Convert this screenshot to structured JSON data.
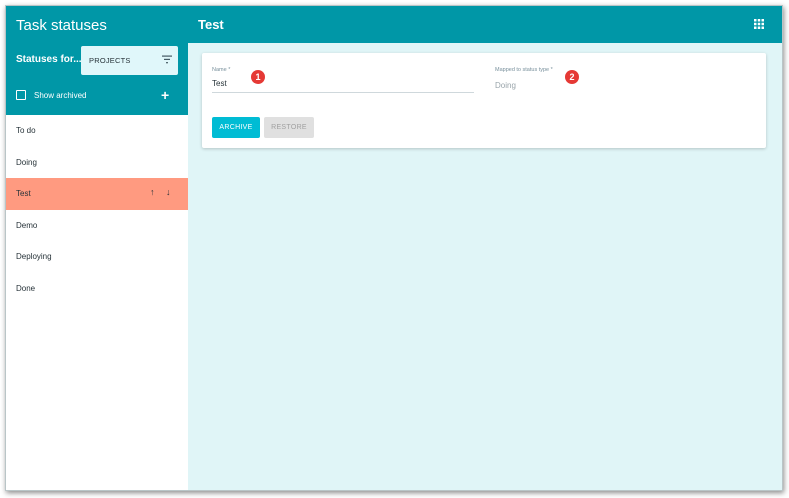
{
  "sidebar": {
    "title": "Task statuses",
    "statuses_for_label": "Statuses for...",
    "projects_select": {
      "value": "PROJECTS",
      "icon": "filter-icon"
    },
    "show_archived_label": "Show archived",
    "show_archived_checked": false,
    "add_icon": "plus-icon",
    "items": [
      {
        "label": "To do"
      },
      {
        "label": "Doing"
      },
      {
        "label": "Test",
        "active": true
      },
      {
        "label": "Demo"
      },
      {
        "label": "Deploying"
      },
      {
        "label": "Done"
      }
    ]
  },
  "main": {
    "title": "Test",
    "apps_icon": "grid-icon",
    "form": {
      "name_label": "Name *",
      "name_value": "Test",
      "mapped_label": "Mapped to status type *",
      "mapped_value": "Doing",
      "badges": [
        "1",
        "2"
      ],
      "archive_label": "ARCHIVE",
      "restore_label": "RESTORE"
    }
  },
  "colors": {
    "header": "#0097a7",
    "main_background": "#e0f5f7",
    "active_item": "#ff9a80",
    "archive_button": "#00bcd4",
    "badge": "#e53935"
  }
}
